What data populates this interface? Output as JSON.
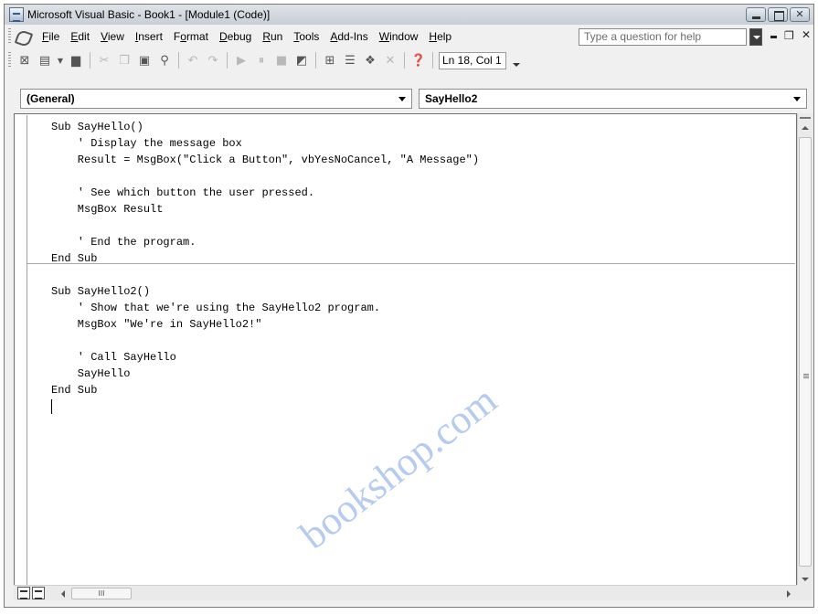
{
  "window": {
    "title": "Microsoft Visual Basic - Book1 - [Module1 (Code)]"
  },
  "menu": {
    "items": [
      {
        "label": "File",
        "accel": "F",
        "rest": "ile"
      },
      {
        "label": "Edit",
        "accel": "E",
        "rest": "dit"
      },
      {
        "label": "View",
        "accel": "V",
        "rest": "iew"
      },
      {
        "label": "Insert",
        "accel": "I",
        "rest": "nsert"
      },
      {
        "label": "Format",
        "pre": "F",
        "accel": "o",
        "rest": "rmat"
      },
      {
        "label": "Debug",
        "accel": "D",
        "rest": "ebug"
      },
      {
        "label": "Run",
        "accel": "R",
        "rest": "un"
      },
      {
        "label": "Tools",
        "accel": "T",
        "rest": "ools"
      },
      {
        "label": "Add-Ins",
        "accel": "A",
        "rest": "dd-Ins"
      },
      {
        "label": "Window",
        "accel": "W",
        "rest": "indow"
      },
      {
        "label": "Help",
        "accel": "H",
        "rest": "elp"
      }
    ],
    "help_placeholder": "Type a question for help"
  },
  "toolbar": {
    "position": "Ln 18, Col 1",
    "icons": [
      "view-excel-icon",
      "insert-module-icon",
      "save-icon",
      "cut-icon",
      "copy-icon",
      "paste-icon",
      "find-icon",
      "undo-icon",
      "redo-icon",
      "run-icon",
      "break-icon",
      "reset-icon",
      "design-mode-icon",
      "project-explorer-icon",
      "properties-icon",
      "object-browser-icon",
      "toolbox-icon",
      "help-icon"
    ]
  },
  "combos": {
    "object": "(General)",
    "procedure": "SayHello2"
  },
  "code": {
    "lines": [
      "Sub SayHello()",
      "    ' Display the message box",
      "    Result = MsgBox(\"Click a Button\", vbYesNoCancel, \"A Message\")",
      "",
      "    ' See which button the user pressed.",
      "    MsgBox Result",
      "",
      "    ' End the program.",
      "End Sub",
      "Sub SayHello2()",
      "    ' Show that we're using the SayHello2 program.",
      "    MsgBox \"We're in SayHello2!\"",
      "",
      "    ' Call SayHello",
      "    SayHello",
      "End Sub"
    ]
  },
  "hscroll": {
    "thumb_label": "III"
  },
  "watermark": "bookshop.com"
}
